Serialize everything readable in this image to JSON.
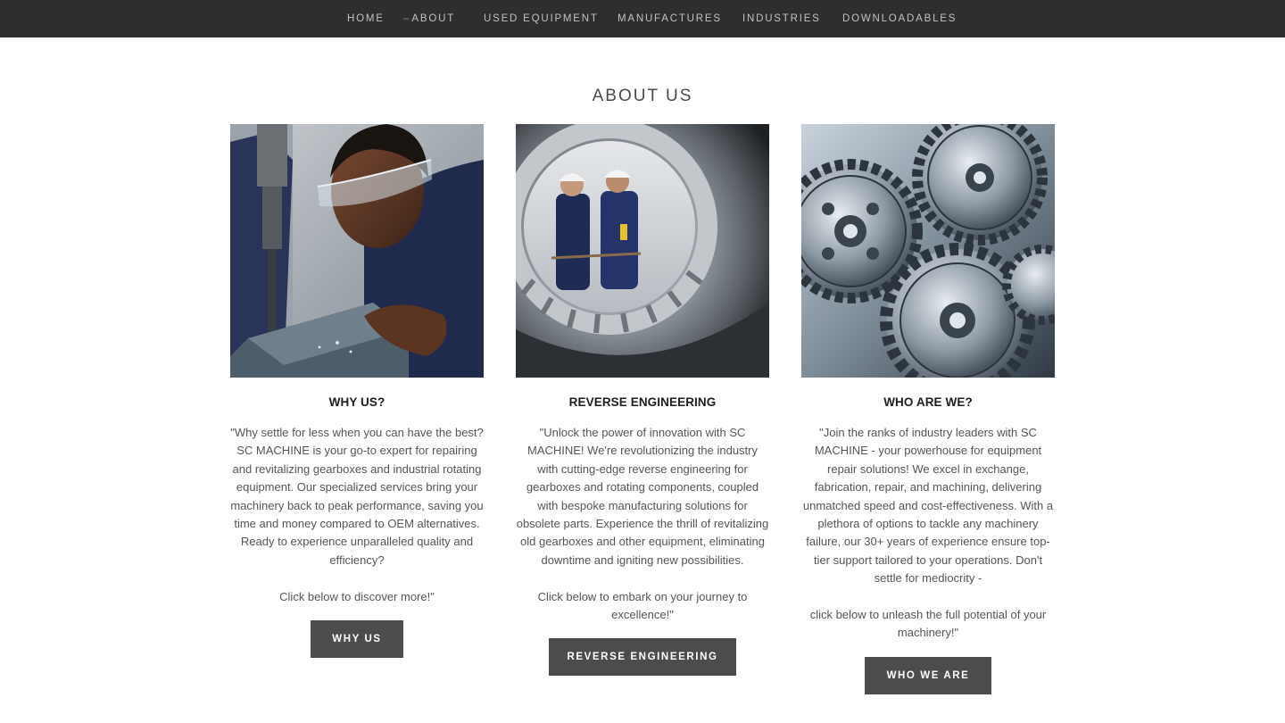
{
  "nav": {
    "items": [
      {
        "label": "HOME"
      },
      {
        "label": "ABOUT",
        "marker": "–"
      },
      {
        "label": "USED EQUIPMENT"
      },
      {
        "label": "MANUFACTURES"
      },
      {
        "label": "INDUSTRIES"
      },
      {
        "label": "DOWNLOADABLES"
      }
    ]
  },
  "page": {
    "title": "ABOUT US"
  },
  "columns": [
    {
      "title": "WHY US?",
      "paragraph1": "\"Why settle for less when you can have the best? SC MACHINE is your go-to expert for repairing and revitalizing gearboxes and industrial rotating equipment. Our specialized services bring your machinery back to peak performance, saving you time and money compared to OEM alternatives. Ready to experience unparalleled quality and efficiency?",
      "paragraph2": "Click below to discover more!\"",
      "button": "WHY US",
      "image": "machinist-drilling-photo"
    },
    {
      "title": "REVERSE ENGINEERING",
      "paragraph1": "\"Unlock the power of innovation with SC MACHINE! We're revolutionizing the industry with cutting-edge reverse engineering for gearboxes and rotating components, coupled with bespoke manufacturing solutions for obsolete parts. Experience the thrill of revitalizing old gearboxes and other equipment, eliminating downtime and igniting new possibilities.",
      "paragraph2": "Click below to embark on your journey to excellence!\"",
      "button": "REVERSE ENGINEERING",
      "image": "engineers-through-gear-photo"
    },
    {
      "title": "WHO ARE WE?",
      "paragraph1": "\"Join the ranks of industry leaders with SC MACHINE - your powerhouse for equipment repair solutions! We excel in exchange, fabrication, repair, and machining, delivering unmatched speed and cost-effectiveness. With a plethora of options to tackle any machinery failure, our 30+ years of experience ensure top-tier support tailored to your operations. Don't settle for mediocrity -",
      "paragraph2": "click below to unleash the full potential of your machinery!\"",
      "button": "WHO WE ARE",
      "image": "steel-gears-photo"
    }
  ],
  "colors": {
    "nav_bg": "#2e2e2e",
    "nav_text": "#c2c2c2",
    "button_bg": "#4c4c4c",
    "body_text": "#555555"
  }
}
